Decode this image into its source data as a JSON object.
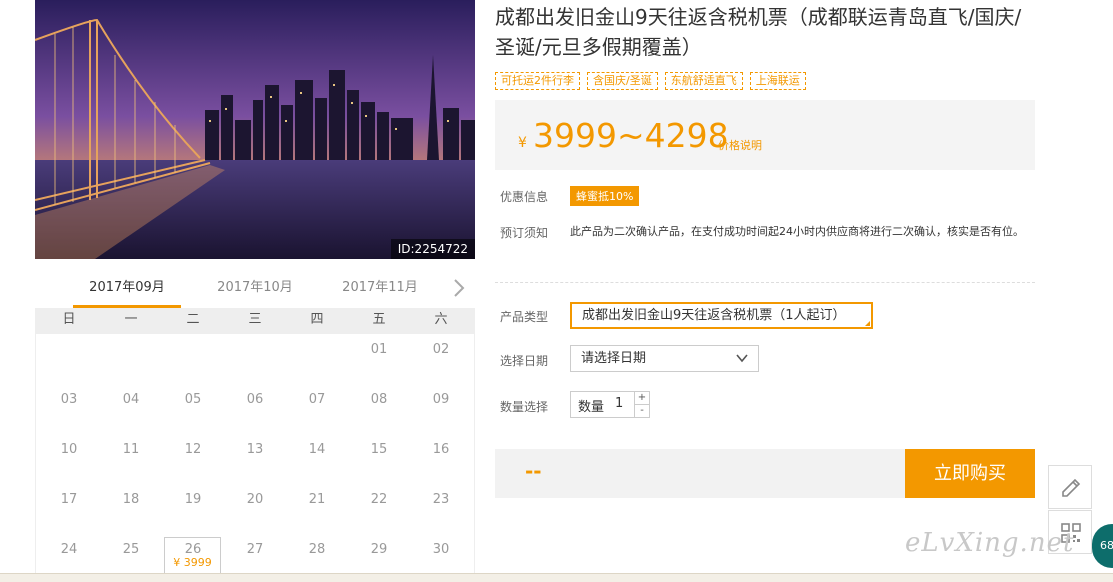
{
  "product": {
    "image_id": "ID:2254722",
    "title": "成都出发旧金山9天往返含税机票（成都联运青岛直飞/国庆/圣诞/元旦多假期覆盖）",
    "tags": [
      "可托运2件行李",
      "含国庆/圣诞",
      "东航舒适直飞",
      "上海联运"
    ]
  },
  "price": {
    "currency": "¥",
    "range": "3999~4298",
    "note": "价格说明"
  },
  "promo": {
    "label": "优惠信息",
    "badge": "蜂蜜抵10%"
  },
  "notice": {
    "label": "预订须知",
    "text": "此产品为二次确认产品，在支付成功时间起24小时内供应商将进行二次确认，核实是否有位。"
  },
  "form": {
    "product_type_label": "产品类型",
    "product_type_value": "成都出发旧金山9天往返含税机票（1人起订）",
    "date_label": "选择日期",
    "date_placeholder": "请选择日期",
    "qty_section_label": "数量选择",
    "qty_label": "数量",
    "qty_value": "1",
    "qty_plus": "+",
    "qty_minus": "-"
  },
  "buy": {
    "price_placeholder": "--",
    "button": "立即购买"
  },
  "calendar": {
    "months": [
      "2017年09月",
      "2017年10月",
      "2017年11月"
    ],
    "active_month": 0,
    "weekdays": [
      "日",
      "一",
      "二",
      "三",
      "四",
      "五",
      "六"
    ],
    "days": [
      "01",
      "02",
      "03",
      "04",
      "05",
      "06",
      "07",
      "08",
      "09",
      "10",
      "11",
      "12",
      "13",
      "14",
      "15",
      "16",
      "17",
      "18",
      "19",
      "20",
      "21",
      "22",
      "23",
      "24",
      "25",
      "26",
      "27",
      "28",
      "29",
      "30"
    ],
    "selected_day": "26",
    "selected_price": "¥ 3999"
  },
  "watermark": "eLvXing.net",
  "badge_number": "68",
  "icons": {
    "next": "chevron-right-icon",
    "dropdown": "chevron-down-icon",
    "edit": "pencil-icon",
    "qr": "qr-code-icon"
  },
  "colors": {
    "accent": "#f39800",
    "price_bg": "#f4f4f4",
    "badge": "#0d6d6b"
  }
}
